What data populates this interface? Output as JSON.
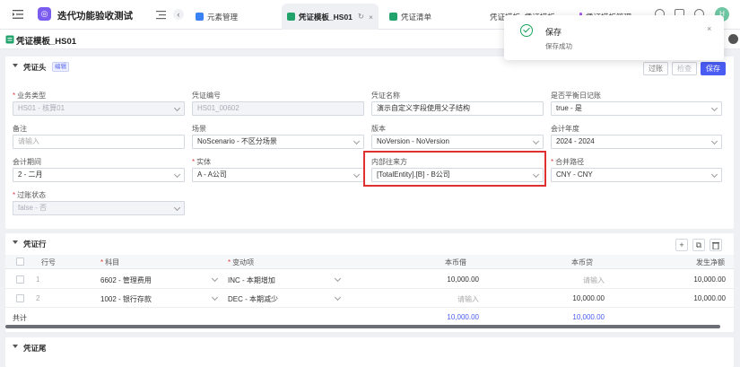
{
  "app": {
    "title": "迭代功能验收测试",
    "logo_glyph": "◎"
  },
  "tabs": [
    {
      "label": "元素管理",
      "icon_color": "#3b82f6"
    },
    {
      "label": "凭证模板_HS01",
      "icon_color": "#22a36b",
      "active": true
    },
    {
      "label": "凭证清单",
      "icon_color": "#22a36b"
    },
    {
      "label": "凭证模板_凭证模板",
      "icon_color": "#22a36b"
    },
    {
      "label": "凭证模板管理",
      "icon_color": "#a855f7"
    }
  ],
  "tab_controls": {
    "prev": "‹",
    "refresh": "↻",
    "close": "×"
  },
  "user": {
    "avatar": "H"
  },
  "page": {
    "title": "凭证模板_HS01"
  },
  "header_card": {
    "title": "凭证头",
    "tag": "编辑",
    "buttons": {
      "post": "过账",
      "check": "检查",
      "save": "保存"
    },
    "fields": [
      {
        "label": "业务类型",
        "required": true,
        "value": "HS01 - 核算01",
        "disabled": true,
        "dropdown": true
      },
      {
        "label": "凭证编号",
        "required": false,
        "value": "HS01_00602",
        "disabled": true,
        "dropdown": false
      },
      {
        "label": "凭证名称",
        "required": false,
        "value": "演示自定义字段使用父子结构",
        "disabled": false,
        "dropdown": false
      },
      {
        "label": "是否平衡日记账",
        "required": false,
        "value": "true - 是",
        "disabled": false,
        "dropdown": true
      },
      {
        "label": "备注",
        "required": false,
        "value": "请输入",
        "placeholder": true,
        "disabled": false,
        "dropdown": false
      },
      {
        "label": "场景",
        "required": false,
        "value": "NoScenario - 不区分场景",
        "disabled": false,
        "dropdown": true
      },
      {
        "label": "版本",
        "required": false,
        "value": "NoVersion - NoVersion",
        "disabled": false,
        "dropdown": true
      },
      {
        "label": "会计年度",
        "required": false,
        "value": "2024 - 2024",
        "disabled": false,
        "dropdown": true
      },
      {
        "label": "会计期间",
        "required": false,
        "value": "2 - 二月",
        "disabled": false,
        "dropdown": true
      },
      {
        "label": "实体",
        "required": true,
        "value": "A - A公司",
        "disabled": false,
        "dropdown": true
      },
      {
        "label": "内部往来方",
        "required": false,
        "value": "[TotalEntity].[B] - B公司",
        "disabled": false,
        "dropdown": true
      },
      {
        "label": "合并路径",
        "required": true,
        "value": "CNY - CNY",
        "disabled": false,
        "dropdown": true
      },
      {
        "label": "过账状态",
        "required": true,
        "value": "false - 否",
        "disabled": true,
        "dropdown": true
      }
    ]
  },
  "lines_card": {
    "title": "凭证行",
    "icon_buttons": {
      "add": "+",
      "copy": "⧉",
      "delete": "🗑"
    },
    "columns": {
      "row_no": "行号",
      "account": "科目",
      "change": "变动项",
      "debit": "本币借",
      "credit": "本币贷",
      "net": "发生净额"
    },
    "rows": [
      {
        "row_no": "1",
        "account": "6602 - 管理费用",
        "change": "INC - 本期增加",
        "debit": "10,000.00",
        "debit_placeholder": false,
        "credit": "请输入",
        "credit_placeholder": true,
        "net": "10,000.00"
      },
      {
        "row_no": "2",
        "account": "1002 - 银行存款",
        "change": "DEC - 本期减少",
        "debit": "请输入",
        "debit_placeholder": true,
        "credit": "10,000.00",
        "credit_placeholder": false,
        "net": "10,000.00"
      }
    ],
    "total": {
      "label": "共计",
      "debit": "10,000.00",
      "credit": "10,000.00"
    }
  },
  "tail_card": {
    "title": "凭证尾"
  },
  "toast": {
    "title": "保存",
    "message": "保存成功",
    "close": "×"
  },
  "colors": {
    "primary": "#4a5cf2",
    "success": "#1aa35a",
    "required": "#e23c3c",
    "highlight": "#e03131"
  }
}
